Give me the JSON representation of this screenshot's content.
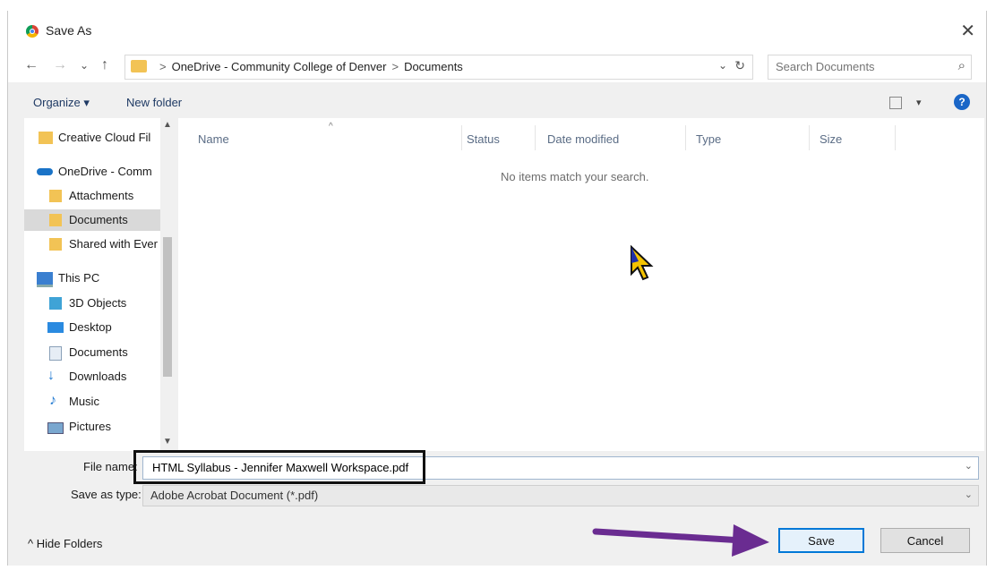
{
  "window": {
    "title": "Save As",
    "close_glyph": "✕"
  },
  "nav": {
    "back_glyph": "←",
    "forward_glyph": "→",
    "recent_glyph": "⌄",
    "up_glyph": "↑",
    "breadcrumb": [
      "OneDrive - Community College of Denver",
      "Documents"
    ],
    "refresh_glyph": "↻",
    "dropdown_glyph": "⌄",
    "search_placeholder": "Search Documents",
    "search_glyph": "⌕"
  },
  "toolbar": {
    "organize_label": "Organize ▾",
    "new_folder_label": "New folder",
    "view_caret": "▾",
    "help_glyph": "?"
  },
  "sidebar": {
    "items": [
      {
        "label": "Creative Cloud Fil",
        "icon": "creative-cloud-folder-icon"
      },
      {
        "label": "OneDrive - Comm",
        "icon": "onedrive-cloud-icon"
      },
      {
        "label": "Attachments",
        "icon": "folder-icon"
      },
      {
        "label": "Documents",
        "icon": "folder-icon",
        "selected": true
      },
      {
        "label": "Shared with Ever",
        "icon": "folder-icon"
      },
      {
        "label": "This PC",
        "icon": "computer-icon"
      },
      {
        "label": "3D Objects",
        "icon": "cube-icon"
      },
      {
        "label": "Desktop",
        "icon": "desktop-icon"
      },
      {
        "label": "Documents",
        "icon": "documents-icon"
      },
      {
        "label": "Downloads",
        "icon": "download-arrow-icon"
      },
      {
        "label": "Music",
        "icon": "music-note-icon"
      },
      {
        "label": "Pictures",
        "icon": "pictures-icon"
      }
    ],
    "scroll_up": "▲",
    "scroll_down": "▼"
  },
  "file_list": {
    "sort_glyph": "^",
    "columns": [
      "Name",
      "Status",
      "Date modified",
      "Type",
      "Size"
    ],
    "empty_message": "No items match your search."
  },
  "form": {
    "file_name_label": "File name:",
    "file_name_value": "HTML Syllabus - Jennifer Maxwell Workspace.pdf",
    "save_as_type_label": "Save as type:",
    "save_as_type_value": "Adobe Acrobat Document (*.pdf)",
    "combo_caret": "⌄"
  },
  "footer": {
    "hide_folders_label": "^  Hide Folders",
    "save_label": "Save",
    "cancel_label": "Cancel"
  },
  "colors": {
    "annotation_arrow": "#6a2c91",
    "accent": "#0078d7"
  }
}
